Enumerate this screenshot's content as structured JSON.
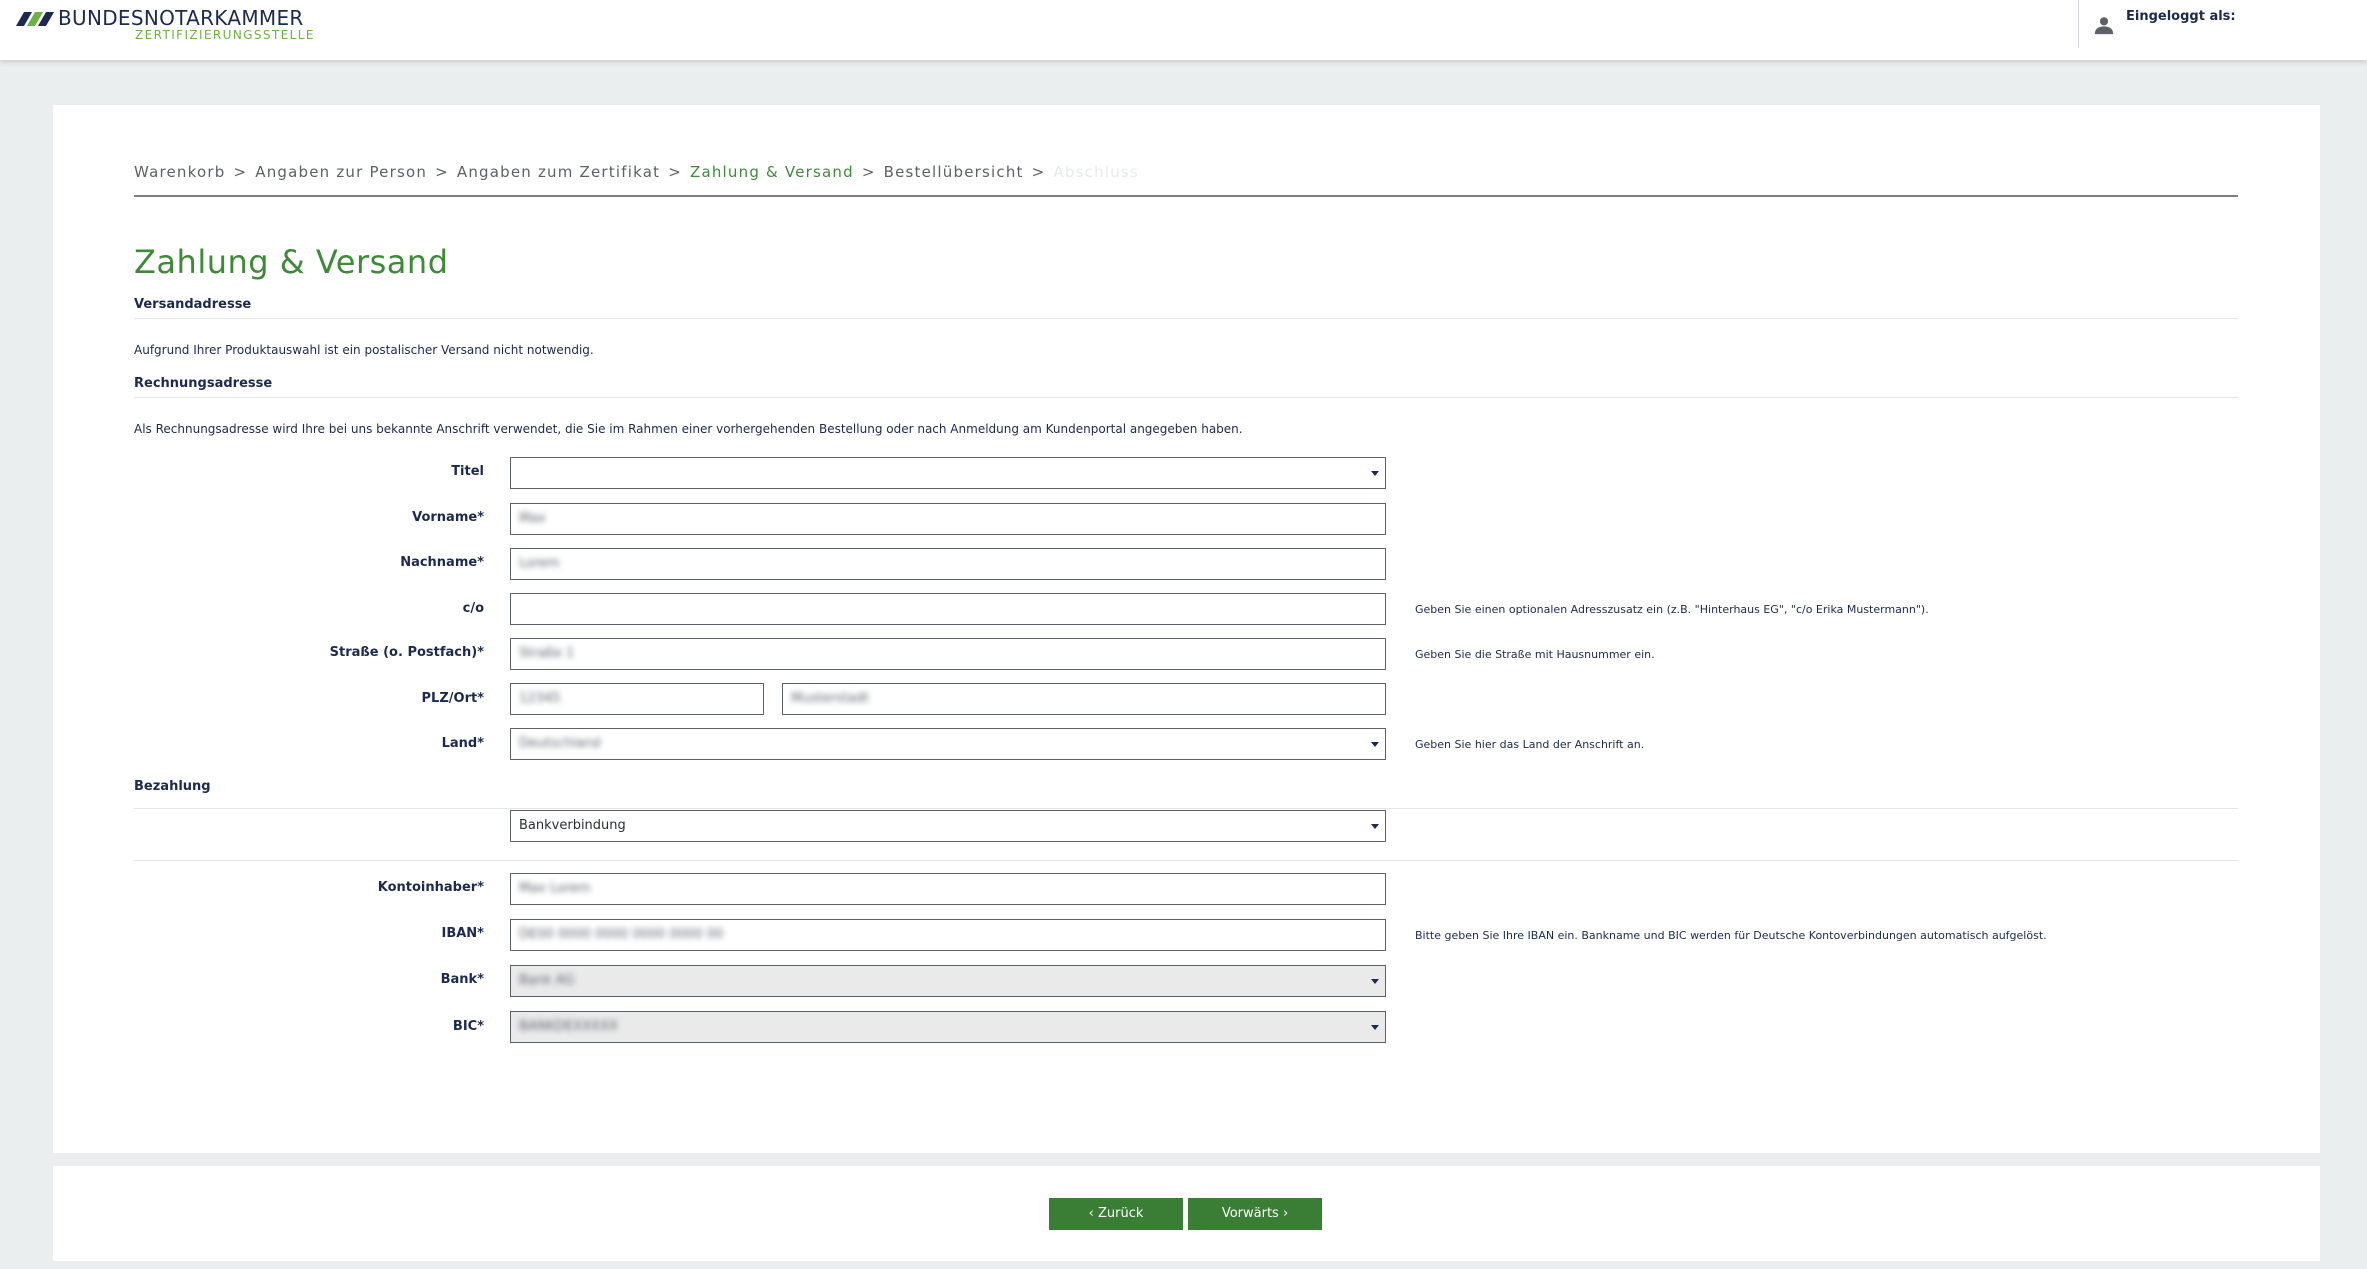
{
  "header": {
    "logo_main": "BUNDESNOTARKAMMER",
    "logo_sub": "ZERTIFIZIERUNGSSTELLE",
    "logged_in_label": "Eingeloggt als:",
    "brand_colors": {
      "navy": "#1b2a4e",
      "green": "#6bb43f"
    }
  },
  "breadcrumb": {
    "items": [
      "Warenkorb",
      "Angaben zur Person",
      "Angaben zum Zertifikat",
      "Zahlung & Versand",
      "Bestellübersicht",
      "Abschluss"
    ],
    "separator": ">",
    "active_index": 3
  },
  "page": {
    "title": "Zahlung & Versand"
  },
  "shipping": {
    "heading": "Versandadresse",
    "info": "Aufgrund Ihrer Produktauswahl ist ein postalischer Versand nicht notwendig."
  },
  "billing": {
    "heading": "Rechnungsadresse",
    "info": "Als Rechnungsadresse wird Ihre bei uns bekannte Anschrift verwendet, die Sie im Rahmen einer vorhergehenden Bestellung oder nach Anmeldung am Kundenportal angegeben haben.",
    "fields": {
      "title": {
        "label": "Titel",
        "value": ""
      },
      "first_name": {
        "label": "Vorname*",
        "value": "Max"
      },
      "last_name": {
        "label": "Nachname*",
        "value": "Lorem"
      },
      "co": {
        "label": "c/o",
        "value": "",
        "hint": "Geben Sie einen optionalen Adresszusatz ein (z.B. \"Hinterhaus EG\", \"c/o Erika Mustermann\")."
      },
      "street": {
        "label": "Straße (o. Postfach)*",
        "value": "Straße 1",
        "hint": "Geben Sie die Straße mit Hausnummer ein."
      },
      "zip_city": {
        "label": "PLZ/Ort*",
        "zip": "12345",
        "city": "Musterstadt"
      },
      "country": {
        "label": "Land*",
        "value": "Deutschland",
        "hint": "Geben Sie hier das Land der Anschrift an."
      }
    }
  },
  "payment": {
    "heading": "Bezahlung",
    "method": "Bankverbindung",
    "fields": {
      "account_holder": {
        "label": "Kontoinhaber*",
        "value": "Max Lorem"
      },
      "iban": {
        "label": "IBAN*",
        "value": "DE00 0000 0000 0000 0000 00",
        "hint": "Bitte geben Sie Ihre IBAN ein. Bankname und BIC werden für Deutsche Kontoverbindungen automatisch aufgelöst."
      },
      "bank": {
        "label": "Bank*",
        "value": "Bank AG"
      },
      "bic": {
        "label": "BIC*",
        "value": "BANKDEXXXXX"
      }
    }
  },
  "footer": {
    "back_label": "Zurück",
    "next_label": "Vorwärts",
    "button_color": "#3a7d34"
  }
}
